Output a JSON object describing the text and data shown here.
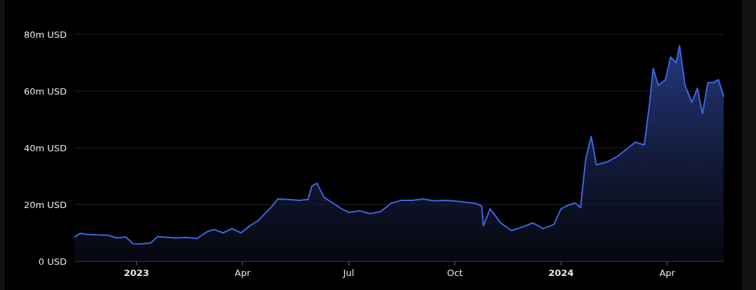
{
  "chart": {
    "chart_data": {
      "type": "area",
      "x": [
        2022.854,
        2022.867,
        2022.883,
        2022.908,
        2022.933,
        2022.954,
        2022.975,
        2022.992,
        2023.008,
        2023.033,
        2023.05,
        2023.067,
        2023.092,
        2023.117,
        2023.142,
        2023.167,
        2023.183,
        2023.204,
        2023.225,
        2023.246,
        2023.267,
        2023.288,
        2023.304,
        2023.317,
        2023.333,
        2023.358,
        2023.383,
        2023.404,
        2023.413,
        2023.425,
        2023.442,
        2023.463,
        2023.483,
        2023.5,
        2023.525,
        2023.55,
        2023.575,
        2023.6,
        2023.625,
        2023.65,
        2023.675,
        2023.7,
        2023.725,
        2023.75,
        2023.775,
        2023.796,
        2023.813,
        2023.817,
        2023.833,
        2023.858,
        2023.883,
        2023.908,
        2023.933,
        2023.958,
        2023.983,
        2024.0,
        2024.017,
        2024.033,
        2024.046,
        2024.058,
        2024.071,
        2024.083,
        2024.108,
        2024.133,
        2024.158,
        2024.175,
        2024.196,
        2024.208,
        2024.217,
        2024.229,
        2024.246,
        2024.258,
        2024.271,
        2024.279,
        2024.292,
        2024.308,
        2024.321,
        2024.333,
        2024.346,
        2024.358,
        2024.371,
        2024.383
      ],
      "series": [
        {
          "color": "#3b66e0",
          "values": [
            8.5,
            9.8,
            9.5,
            9.3,
            9.2,
            8.2,
            8.6,
            6.2,
            6.1,
            6.4,
            8.7,
            8.5,
            8.2,
            8.4,
            8.0,
            10.5,
            11.2,
            10.0,
            11.5,
            10.0,
            12.5,
            14.5,
            17,
            19,
            22,
            21.8,
            21.5,
            21.8,
            26.5,
            27.5,
            22.5,
            20.5,
            18.5,
            17.2,
            17.8,
            16.8,
            17.5,
            20.5,
            21.5,
            21.5,
            22,
            21.3,
            21.5,
            21.2,
            20.8,
            20.5,
            19.5,
            12.5,
            18.5,
            13.5,
            10.8,
            12,
            13.5,
            11.5,
            13,
            18.5,
            19.8,
            20.5,
            19,
            36,
            44,
            34,
            35,
            37,
            40,
            42,
            41,
            55,
            68,
            62,
            64,
            72,
            70,
            76,
            62,
            56,
            61,
            52,
            63,
            63,
            64,
            58
          ]
        }
      ],
      "xlim": [
        2022.854,
        2024.383
      ],
      "ylim": [
        0,
        80
      ],
      "grid": true,
      "xticks": [
        {
          "value": 2023,
          "label": "2023"
        },
        {
          "value": 2023.25,
          "label": "Apr"
        },
        {
          "value": 2023.5,
          "label": "Jul"
        },
        {
          "value": 2023.75,
          "label": "Oct"
        },
        {
          "value": 2024,
          "label": "2024"
        },
        {
          "value": 2024.25,
          "label": "Apr"
        }
      ],
      "yticks": [
        {
          "value": 0,
          "label": "0 USD"
        },
        {
          "value": 20,
          "label": "20m USD"
        },
        {
          "value": 40,
          "label": "40m USD"
        },
        {
          "value": 60,
          "label": "60m USD"
        },
        {
          "value": 80,
          "label": "80m USD"
        }
      ]
    }
  }
}
